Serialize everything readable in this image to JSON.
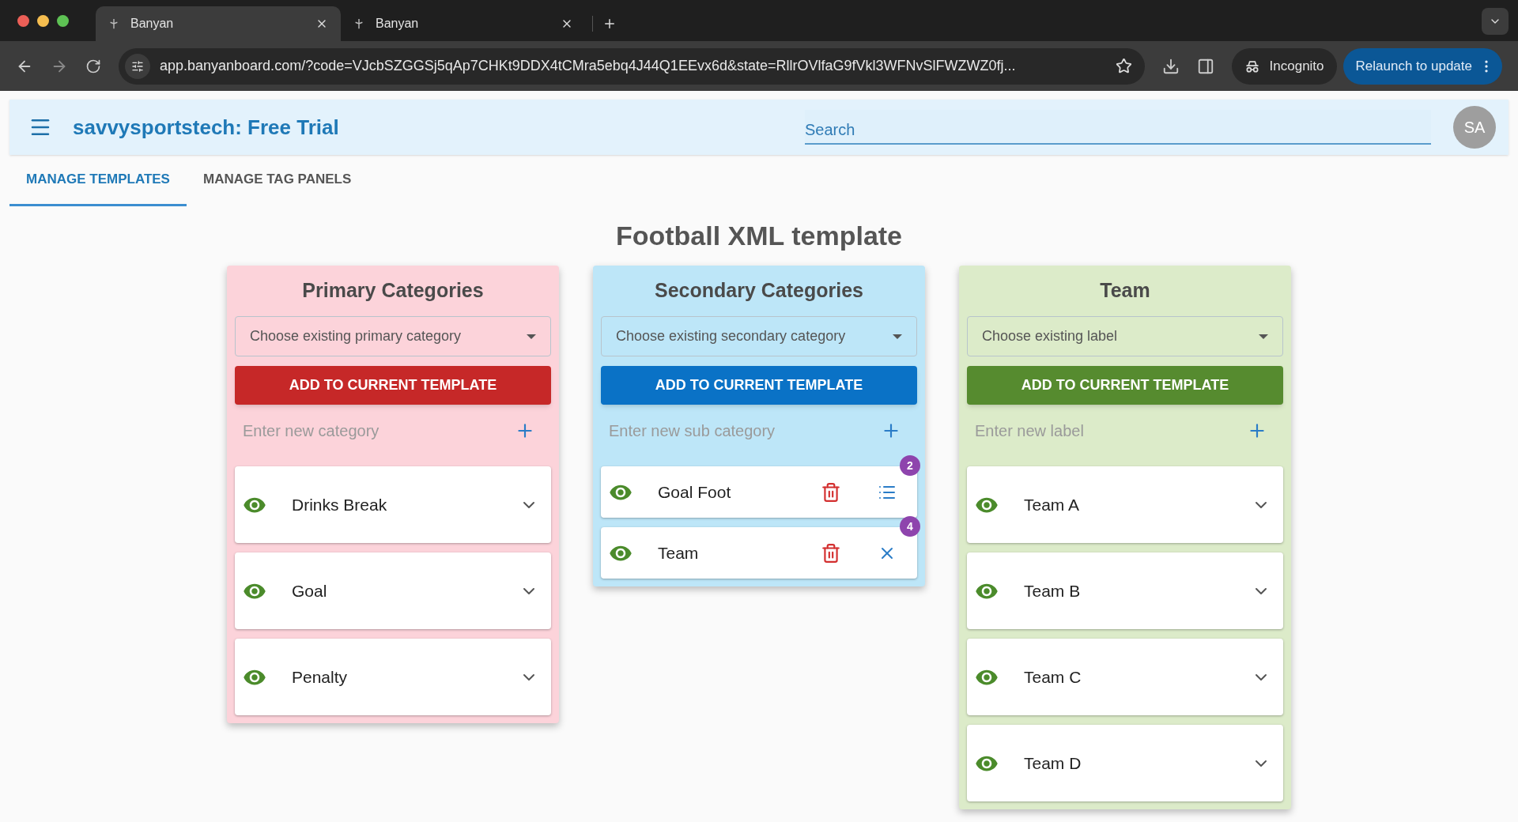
{
  "browser": {
    "tabs": [
      {
        "title": "Banyan",
        "selected": true
      },
      {
        "title": "Banyan",
        "selected": false
      }
    ],
    "url": "app.banyanboard.com/?code=VJcbSZGGSj5qAp7CHKt9DDX4tCMra5ebq4J44Q1EEvx6d&state=RllrOVlfaG9fVkl3WFNvSlFWZWZ0fj...",
    "incognito_label": "Incognito",
    "relaunch_button": "Relaunch to update"
  },
  "header": {
    "title": "savvysportstech: Free Trial",
    "search": {
      "placeholder": "Search"
    },
    "avatar": "SA"
  },
  "tabs": [
    {
      "label": "MANAGE TEMPLATES",
      "selected": true
    },
    {
      "label": "MANAGE TAG PANELS",
      "selected": false
    }
  ],
  "template_title": "Football XML template",
  "cards": [
    {
      "kind": "primary",
      "color": "#c62828",
      "title": "Primary Categories",
      "dropdown": {
        "placeholder": "Choose existing primary category"
      },
      "button": "ADD TO CURRENT TEMPLATE",
      "new_item": {
        "placeholder": "Enter new category"
      },
      "items": [
        {
          "label": "Drinks Break",
          "visible": true
        },
        {
          "label": "Goal",
          "visible": true
        },
        {
          "label": "Penalty",
          "visible": true
        }
      ]
    },
    {
      "kind": "secondary",
      "color": "#0a72c6",
      "title": "Secondary Categories",
      "dropdown": {
        "placeholder": "Choose existing secondary category"
      },
      "button": "ADD TO CURRENT TEMPLATE",
      "new_item": {
        "placeholder": "Enter new sub category"
      },
      "items": [
        {
          "label": "Goal Foot",
          "visible": true,
          "badge": "2",
          "expanded": false
        },
        {
          "label": "Team",
          "visible": true,
          "badge": "4",
          "expanded": true
        }
      ]
    },
    {
      "kind": "label",
      "color": "#568b2f",
      "title": "Team",
      "dropdown": {
        "placeholder": "Choose existing label"
      },
      "button": "ADD TO CURRENT TEMPLATE",
      "new_item": {
        "placeholder": "Enter new label"
      },
      "items": [
        {
          "label": "Team A",
          "visible": true
        },
        {
          "label": "Team B",
          "visible": true
        },
        {
          "label": "Team C",
          "visible": true
        },
        {
          "label": "Team D",
          "visible": true
        }
      ]
    }
  ]
}
